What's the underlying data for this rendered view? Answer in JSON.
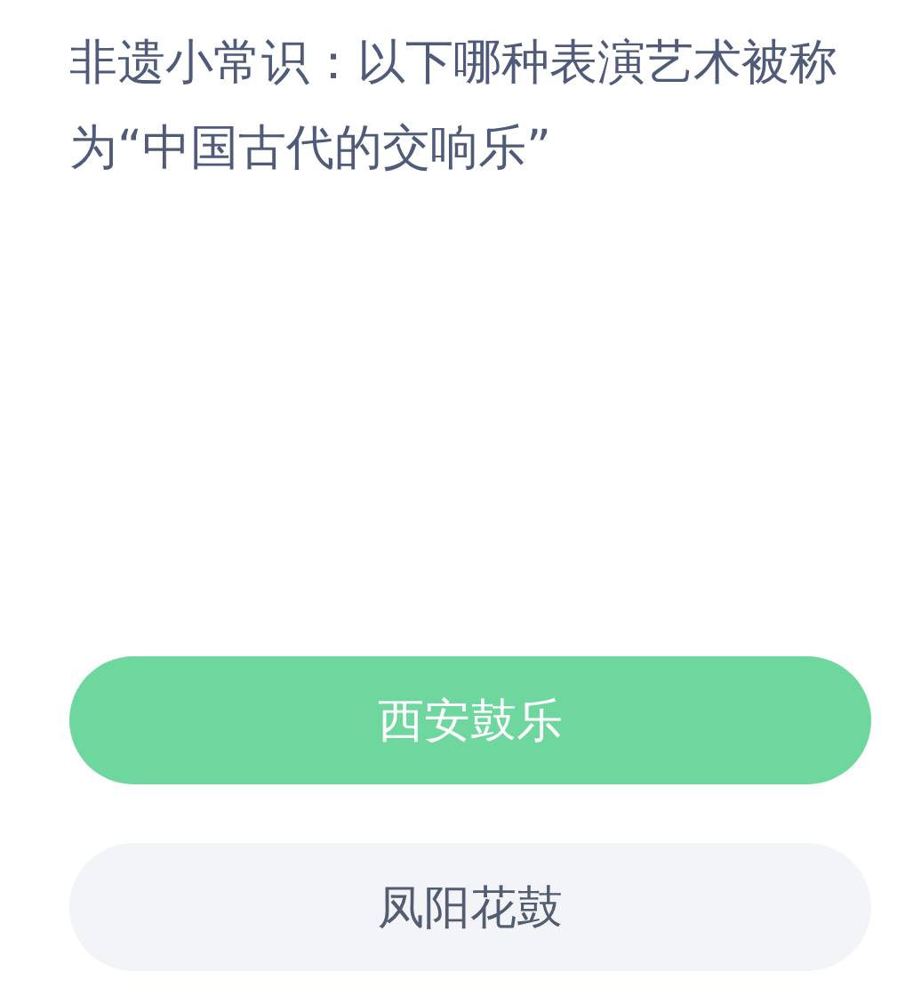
{
  "question": "非遗小常识：以下哪种表演艺术被称为“中国古代的交响乐”",
  "options": [
    {
      "label": "西安鼓乐",
      "selected": true
    },
    {
      "label": "凤阳花鼓",
      "selected": false
    }
  ]
}
